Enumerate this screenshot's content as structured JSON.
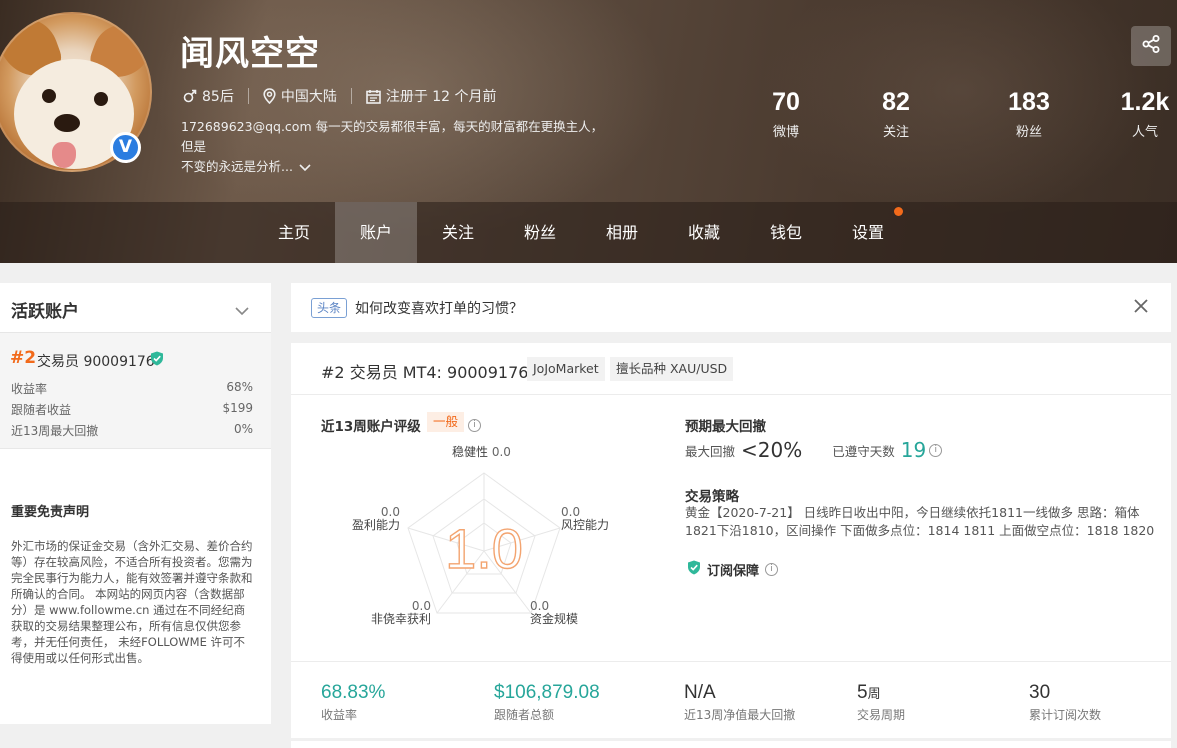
{
  "profile": {
    "name": "闻风空空",
    "age_group": "85后",
    "location": "中国大陆",
    "registered": "注册于 12 个月前",
    "bio_line1": "172689623@qq.com 每一天的交易都很丰富，每天的财富都在更换主人，但是",
    "bio_line2": "不变的永远是分析...",
    "verified_mark": "V"
  },
  "stats": [
    {
      "value": "70",
      "label": "微博"
    },
    {
      "value": "82",
      "label": "关注"
    },
    {
      "value": "183",
      "label": "粉丝"
    },
    {
      "value": "1.2k",
      "label": "人气"
    }
  ],
  "nav": {
    "home": "主页",
    "account": "账户",
    "following": "关注",
    "fans": "粉丝",
    "album": "相册",
    "favorites": "收藏",
    "wallet": "钱包",
    "settings": "设置"
  },
  "sidebar": {
    "title": "活跃账户",
    "rank": "#2",
    "account_title": "交易员 90009176",
    "rows": [
      {
        "label": "收益率",
        "value": "68%"
      },
      {
        "label": "跟随者收益",
        "value": "$199"
      },
      {
        "label": "近13周最大回撤",
        "value": "0%"
      }
    ],
    "disclaimer_title": "重要免责声明",
    "disclaimer_body": "外汇市场的保证金交易（含外汇交易、差价合约等）存在较高风险，不适合所有投资者。您需为完全民事行为能力人，能有效签署并遵守条款和所确认的合同。 本网站的网页内容（含数据部分）是 www.followme.cn 通过在不同经纪商获取的交易结果整理公布，所有信息仅供您参考，并无任何责任， 未经FOLLOWME 许可不得使用或以任何形式出售。"
  },
  "notice": {
    "tag": "头条",
    "question": "如何改变喜欢打单的习惯？"
  },
  "card": {
    "rank": "#2",
    "title": "交易员  MT4: 90009176",
    "broker": "JoJoMarket",
    "specialty": "擅长品种 XAU/USD",
    "rating_title": "近13周账户评级",
    "rating_badge": "一般",
    "score": "1.0",
    "radar": {
      "stability_label": "稳健性",
      "stability_value": "0.0",
      "risk_label": "风控能力",
      "risk_value": "0.0",
      "scale_label": "资金规模",
      "scale_value": "0.0",
      "nonluck_label": "非侥幸获利",
      "nonluck_value": "0.0",
      "profit_label": "盈利能力",
      "profit_value": "0.0"
    },
    "drawdown_title": "预期最大回撤",
    "max_drawdown_label": "最大回撤",
    "max_drawdown_value": "<20%",
    "days_label": "已遵守天数",
    "days_value": "19",
    "strategy_title": "交易策略",
    "strategy_text": "黄金【2020-7-21】 日线昨日收出中阳，今日继续依托1811一线做多 思路：箱体1821下沿1810，区间操作 下面做多点位：1814 1811 上面做空点位：1818 1820",
    "guarantee": "订阅保障",
    "metrics": [
      {
        "value": "68.83%",
        "label": "收益率"
      },
      {
        "value": "$106,879.08",
        "label": "跟随者总额"
      },
      {
        "value": "N/A",
        "label": "近13周净值最大回撤"
      },
      {
        "value": "5",
        "unit": "周",
        "label": "交易周期"
      },
      {
        "value": "30",
        "label": "累计订阅次数"
      }
    ]
  },
  "colors": {
    "accent_orange": "#f26a1b",
    "teal": "#27a69a",
    "verified_blue": "#2b7de0"
  }
}
